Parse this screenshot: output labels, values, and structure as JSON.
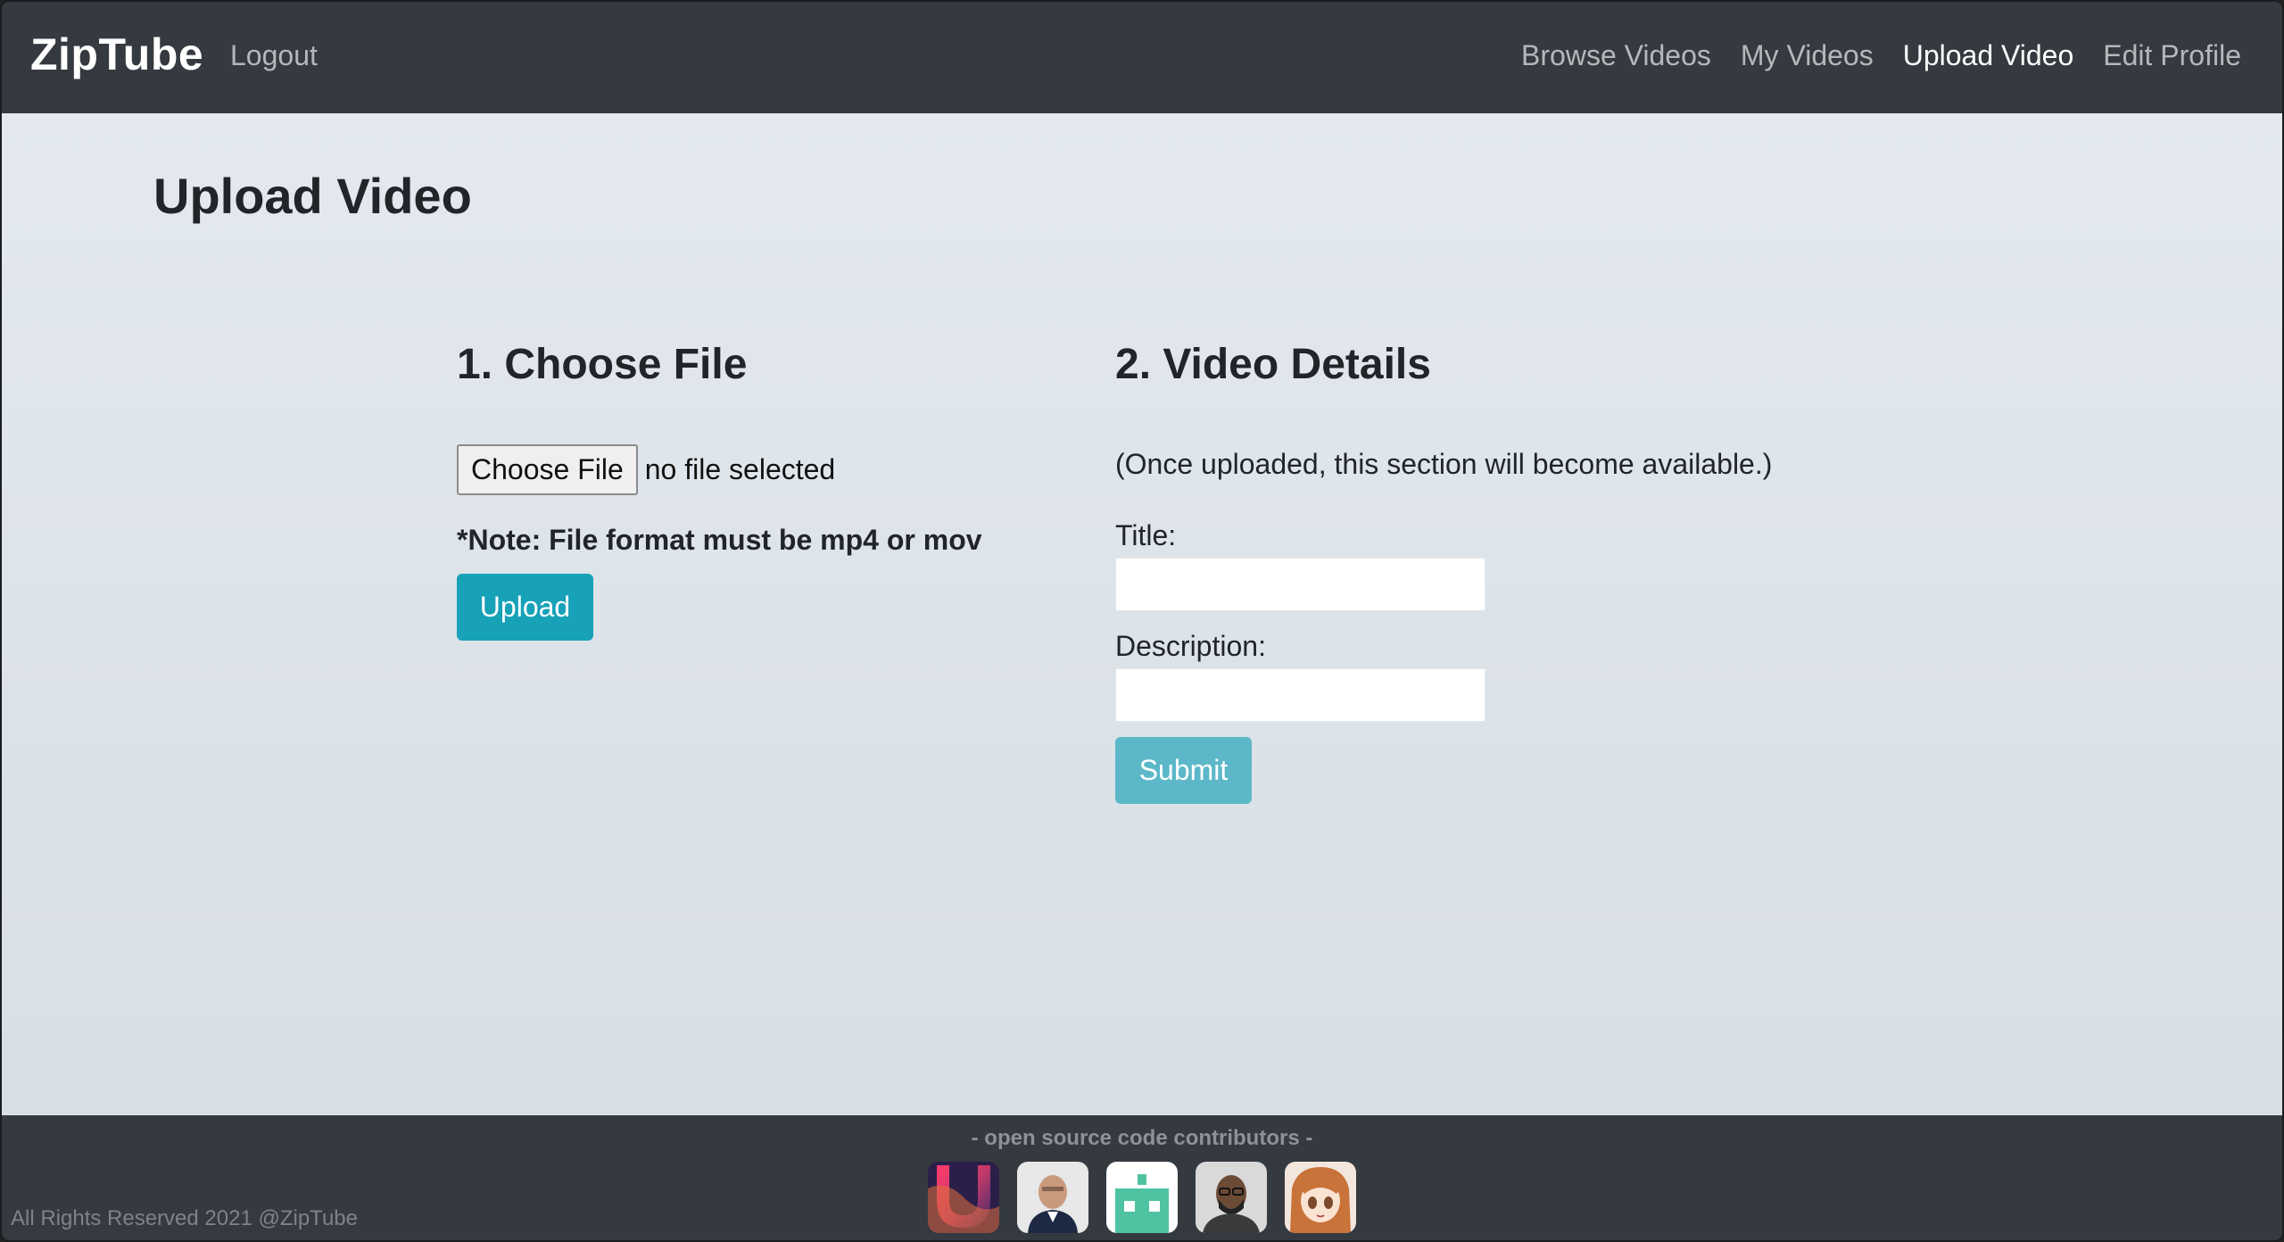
{
  "nav": {
    "brand": "ZipTube",
    "logout": "Logout",
    "links": [
      "Browse Videos",
      "My Videos",
      "Upload Video",
      "Edit Profile"
    ],
    "active": "Upload Video"
  },
  "page": {
    "title": "Upload Video"
  },
  "choose_file": {
    "heading": "1. Choose File",
    "button_label": "Choose File",
    "status": "no file selected",
    "note": "*Note: File format must be mp4 or mov",
    "upload_label": "Upload"
  },
  "details": {
    "heading": "2. Video Details",
    "note": "(Once uploaded, this section will become available.)",
    "title_label": "Title:",
    "title_value": "",
    "description_label": "Description:",
    "description_value": "",
    "submit_label": "Submit"
  },
  "footer": {
    "contributors_heading": "-  open source code contributors -",
    "contributors": [
      {
        "icon": "gradient-u-logo-icon"
      },
      {
        "icon": "person-photo-icon"
      },
      {
        "icon": "robot-avatar-icon"
      },
      {
        "icon": "person-photo-icon"
      },
      {
        "icon": "anime-avatar-icon"
      }
    ],
    "copyright": "All Rights Reserved 2021 @ZipTube"
  },
  "colors": {
    "navbar": "#343a40",
    "primary_button": "#17a2b8",
    "disabled_button": "#5cb8c9",
    "background": "#e3e9ef"
  }
}
